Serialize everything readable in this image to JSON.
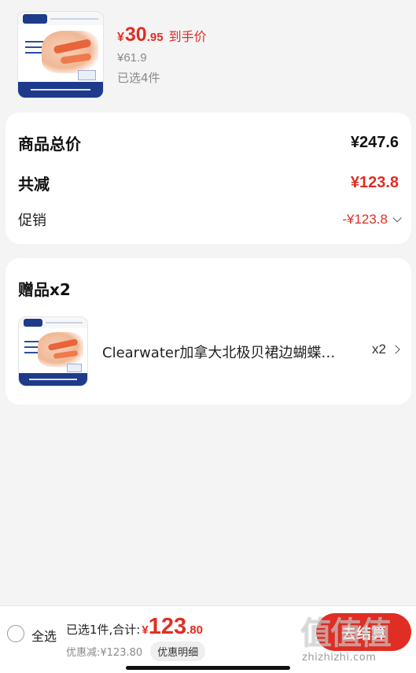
{
  "product": {
    "price_currency": "¥",
    "price_int": "30",
    "price_dec": ".95",
    "price_tag": "到手价",
    "original_price": "¥61.9",
    "selected_count": "已选4件"
  },
  "summary": {
    "total_label": "商品总价",
    "total_value": "¥247.6",
    "reduce_label": "共减",
    "reduce_value": "¥123.8",
    "promo_label": "促销",
    "promo_value": "-¥123.8"
  },
  "gift": {
    "title": "赠品x2",
    "item_name": "Clearwater加拿大北极贝裙边蝴蝶…",
    "item_qty": "x2"
  },
  "bottom_bar": {
    "select_all": "全选",
    "total_prefix": "已选1件,合计:",
    "total_currency": "¥",
    "total_int": "123",
    "total_dec": ".80",
    "discount_text": "优惠减:¥123.80",
    "detail_button": "优惠明细",
    "checkout_button": "去结算",
    "watermark_big": "值值值",
    "watermark_small": "zhizhizhi.com"
  },
  "colors": {
    "accent_red": "#e02e24",
    "background": "#f4f4f4",
    "brand_blue": "#1d3b8a"
  }
}
